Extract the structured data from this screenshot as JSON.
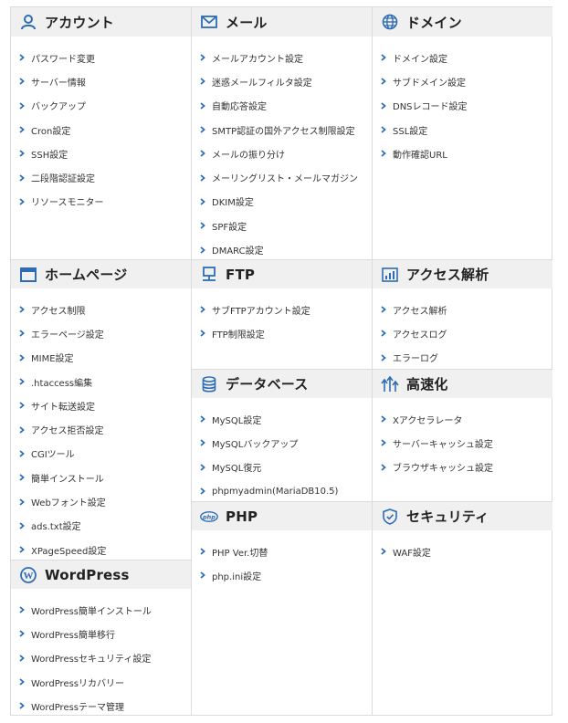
{
  "colors": {
    "accent": "#2e6db4",
    "header_bg": "#f0f0f0",
    "border": "#dcdcdc"
  },
  "col1": {
    "account": {
      "title": "アカウント",
      "icon": "user-icon",
      "items": [
        "パスワード変更",
        "サーバー情報",
        "バックアップ",
        "Cron設定",
        "SSH設定",
        "二段階認証設定",
        "リソースモニター"
      ]
    },
    "homepage": {
      "title": "ホームページ",
      "icon": "browser-window-icon",
      "items": [
        "アクセス制限",
        "エラーページ設定",
        "MIME設定",
        ".htaccess編集",
        "サイト転送設定",
        "アクセス拒否設定",
        "CGIツール",
        "簡単インストール",
        "Webフォント設定",
        "ads.txt設定",
        "XPageSpeed設定"
      ]
    },
    "wordpress": {
      "title": "WordPress",
      "icon": "wordpress-icon",
      "items": [
        "WordPress簡単インストール",
        "WordPress簡単移行",
        "WordPressセキュリティ設定",
        "WordPressリカバリー",
        "WordPressテーマ管理"
      ]
    }
  },
  "col2": {
    "mail": {
      "title": "メール",
      "icon": "envelope-icon",
      "items": [
        "メールアカウント設定",
        "迷惑メールフィルタ設定",
        "自動応答設定",
        "SMTP認証の国外アクセス制限設定",
        "メールの振り分け",
        "メーリングリスト・メールマガジン",
        "DKIM設定",
        "SPF設定",
        "DMARC設定"
      ]
    },
    "ftp": {
      "title": "FTP",
      "icon": "monitor-network-icon",
      "items": [
        "サブFTPアカウント設定",
        "FTP制限設定"
      ]
    },
    "database": {
      "title": "データベース",
      "icon": "database-icon",
      "items": [
        "MySQL設定",
        "MySQLバックアップ",
        "MySQL復元",
        "phpmyadmin(MariaDB10.5)"
      ]
    },
    "php": {
      "title": "PHP",
      "icon": "php-icon",
      "items": [
        "PHP Ver.切替",
        "php.ini設定"
      ]
    }
  },
  "col3": {
    "domain": {
      "title": "ドメイン",
      "icon": "globe-icon",
      "items": [
        "ドメイン設定",
        "サブドメイン設定",
        "DNSレコード設定",
        "SSL設定",
        "動作確認URL"
      ]
    },
    "analytics": {
      "title": "アクセス解析",
      "icon": "bar-chart-icon",
      "items": [
        "アクセス解析",
        "アクセスログ",
        "エラーログ"
      ]
    },
    "speed": {
      "title": "高速化",
      "icon": "speed-arrows-icon",
      "items": [
        "Xアクセラレータ",
        "サーバーキャッシュ設定",
        "ブラウザキャッシュ設定"
      ]
    },
    "security": {
      "title": "セキュリティ",
      "icon": "shield-icon",
      "items": [
        "WAF設定"
      ]
    }
  }
}
